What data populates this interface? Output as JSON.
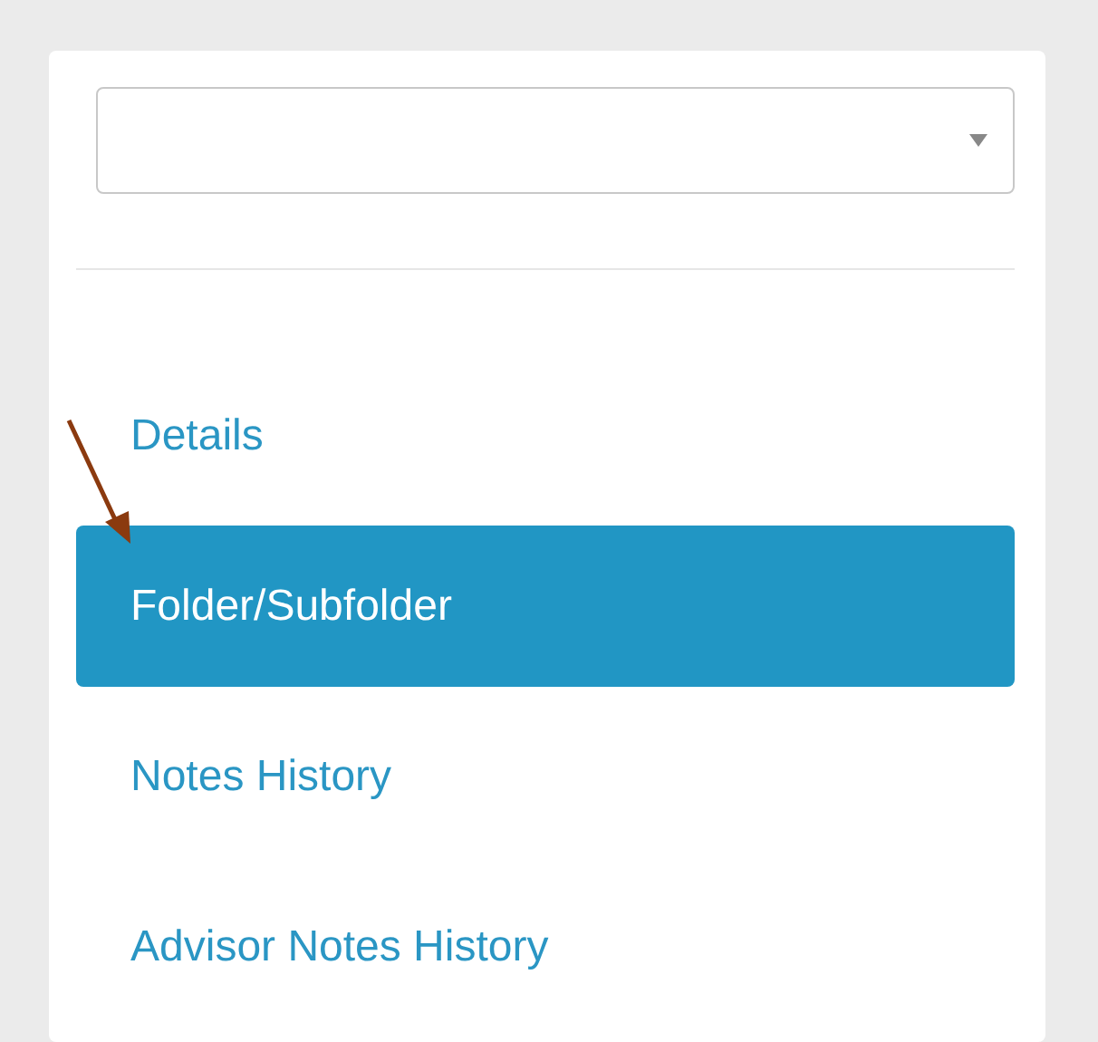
{
  "nav": [
    {
      "label": "Details",
      "selected": false
    },
    {
      "label": "Folder/Subfolder",
      "selected": true
    },
    {
      "label": "Notes History",
      "selected": false
    },
    {
      "label": "Advisor Notes History",
      "selected": false
    }
  ],
  "annotations": [
    {
      "kind": "arrow",
      "color": "#8b3a0f"
    }
  ]
}
